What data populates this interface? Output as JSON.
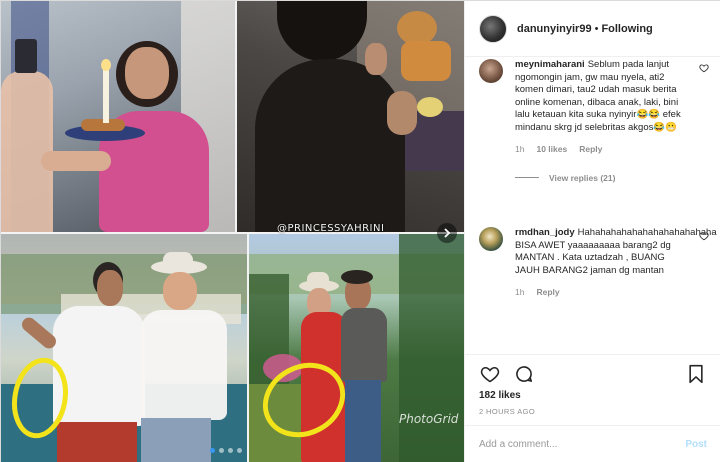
{
  "post": {
    "username": "danunyinyir99",
    "follow_state": "Following",
    "separator": "•"
  },
  "media": {
    "watermark": "@PRINCESSYAHRINI",
    "carousel_dots": 4,
    "active_dot": 0,
    "highlight_color": "#f2e31b"
  },
  "comments": [
    {
      "username": "meynimaharani",
      "text": "Seblum pada lanjut ngomongin jam, gw mau nyela, ati2 komen dimari, tau2 udah masuk berita online komenan, dibaca anak, laki, bini lalu ketauan kita suka nyinyir😂😂 efek mindanu skrg jd selebritas akgos😂😬",
      "time": "1h",
      "likes": "10 likes",
      "reply": "Reply",
      "view_replies": "View replies (21)"
    },
    {
      "username": "rmdhan_jody",
      "text": "Hahahahahahahahahahahahaha BISA AWET yaaaaaaaaa barang2 dg MANTAN . Kata uztadzah , BUANG JAUH BARANG2 jaman dg mantan",
      "time": "1h",
      "reply": "Reply"
    }
  ],
  "actions": {
    "likes": "182 likes",
    "timestamp": "2 HOURS AGO"
  },
  "add_comment": {
    "placeholder": "Add a comment...",
    "post_label": "Post"
  },
  "colors": {
    "link_blue": "#3897f0",
    "post_disabled": "#b2dffc",
    "muted": "#8e8e8e"
  }
}
